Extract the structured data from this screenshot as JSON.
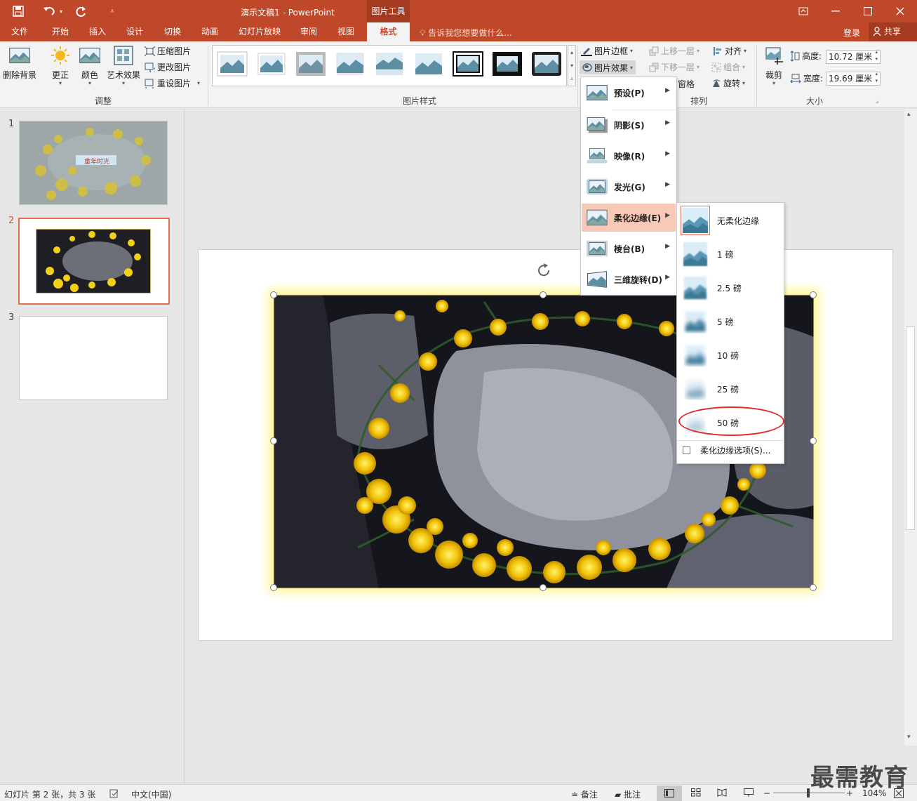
{
  "title": "演示文稿1 - PowerPoint",
  "context_tab": "图片工具",
  "tabs": [
    {
      "label": "文件"
    },
    {
      "label": "开始"
    },
    {
      "label": "插入"
    },
    {
      "label": "设计"
    },
    {
      "label": "切换"
    },
    {
      "label": "动画"
    },
    {
      "label": "幻灯片放映"
    },
    {
      "label": "审阅"
    },
    {
      "label": "视图"
    },
    {
      "label": "格式"
    }
  ],
  "tell_me": "告诉我您想要做什么...",
  "login": "登录",
  "share": "共享",
  "ribbon": {
    "remove_bg": "删除背景",
    "corrections": "更正",
    "color": "颜色",
    "artistic": "艺术效果",
    "compress": "压缩图片",
    "change": "更改图片",
    "reset": "重设图片",
    "adjust_group": "调整",
    "styles_group": "图片样式",
    "border": "图片边框",
    "effects": "图片效果",
    "bring_forward": "上移一层",
    "send_backward": "下移一层",
    "pane": "窗格",
    "align": "对齐",
    "group": "组合",
    "rotate": "旋转",
    "arrange_group": "排列",
    "crop": "裁剪",
    "height_label": "高度:",
    "height_value": "10.72 厘米",
    "width_label": "宽度:",
    "width_value": "19.69 厘米",
    "size_group": "大小"
  },
  "slides": [
    {
      "num": "1",
      "caption": "童年时光"
    },
    {
      "num": "2"
    },
    {
      "num": "3"
    }
  ],
  "effects_menu": [
    {
      "label": "预设(P)"
    },
    {
      "label": "阴影(S)"
    },
    {
      "label": "映像(R)"
    },
    {
      "label": "发光(G)"
    },
    {
      "label": "柔化边缘(E)"
    },
    {
      "label": "棱台(B)"
    },
    {
      "label": "三维旋转(D)"
    }
  ],
  "soft_edges": [
    {
      "label": "无柔化边缘"
    },
    {
      "label": "1 磅"
    },
    {
      "label": "2.5 磅"
    },
    {
      "label": "5 磅"
    },
    {
      "label": "10 磅"
    },
    {
      "label": "25 磅"
    },
    {
      "label": "50 磅"
    }
  ],
  "soft_edge_options": "柔化边缘选项(S)...",
  "status": {
    "slide_info": "幻灯片 第 2 张，共 3 张",
    "language": "中文(中国)",
    "notes": "备注",
    "comments": "批注",
    "zoom": "104%"
  },
  "watermark": "最需教育",
  "colors": {
    "accent": "#c0482a",
    "highlight": "#f8c9b6",
    "annotation": "#e02b2b"
  }
}
